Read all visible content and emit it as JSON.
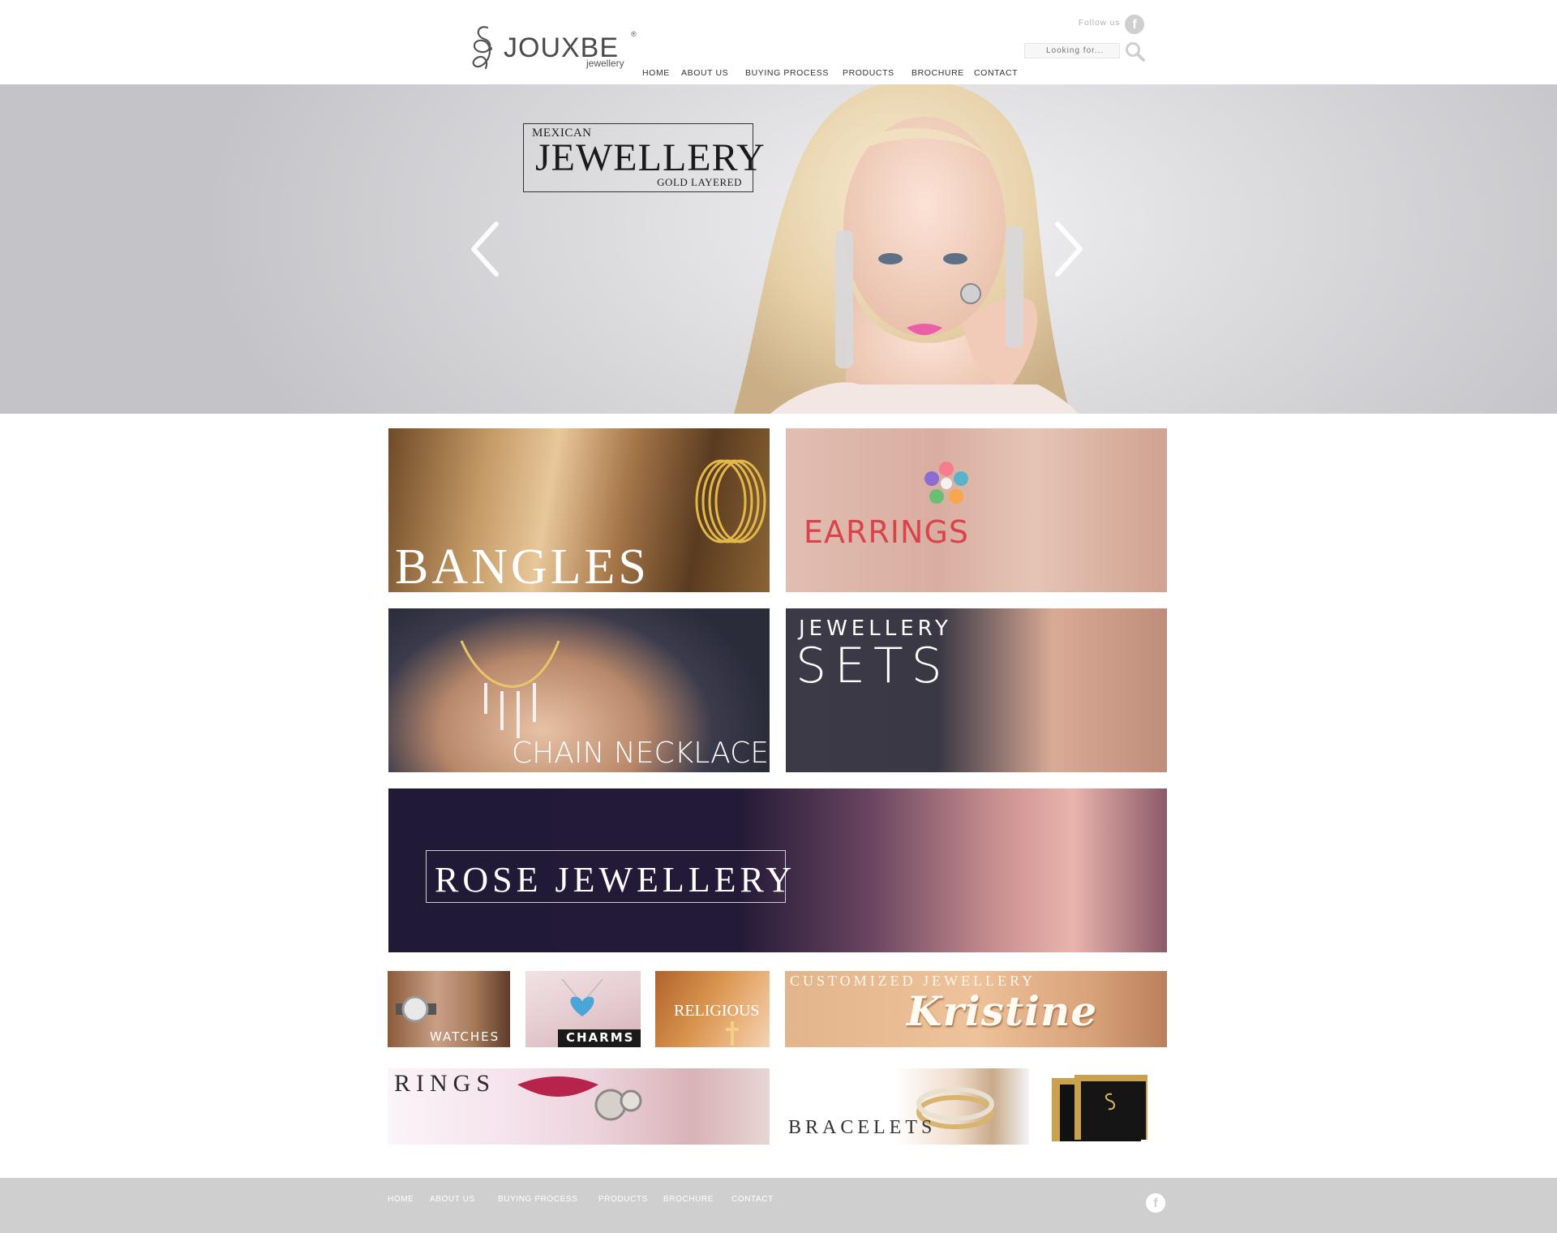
{
  "brand": {
    "name": "JOUXBE",
    "registered": "®",
    "subtitle": "jewellery"
  },
  "header": {
    "follow_label": "Follow us",
    "facebook_glyph": "f",
    "search_placeholder": "Looking for...",
    "nav": [
      "HOME",
      "ABOUT US",
      "BUYING PROCESS",
      "PRODUCTS",
      "BROCHURE",
      "CONTACT"
    ]
  },
  "hero": {
    "badge_top": "MEXICAN",
    "badge_main": "JEWELLERY",
    "badge_bottom": "GOLD LAYERED"
  },
  "tiles": {
    "bangles": "BANGLES",
    "earrings": "EARRINGS",
    "chain": "CHAIN NECKLACES",
    "sets_line1": "JEWELLERY",
    "sets_line2": "SETS",
    "rose": "ROSE JEWELLERY",
    "watches": "WATCHES",
    "charms": "CHARMS",
    "religious": "RELIGIOUS",
    "custom": "CUSTOMIZED JEWELLERY",
    "custom_script": "Kristine",
    "rings": "RINGS",
    "bracelets": "BRACELETS"
  },
  "footer": {
    "nav": [
      "HOME",
      "ABOUT US",
      "BUYING PROCESS",
      "PRODUCTS",
      "BROCHURE",
      "CONTACT"
    ],
    "facebook_glyph": "f"
  },
  "colors": {
    "footer_bg": "#cfcfcf",
    "earrings_text": "#d9444c",
    "rose_bg": "#231a37",
    "nav_text": "#333333"
  },
  "icons": [
    "logo-monogram-icon",
    "facebook-icon",
    "search-icon",
    "chevron-left-icon",
    "chevron-right-icon"
  ]
}
